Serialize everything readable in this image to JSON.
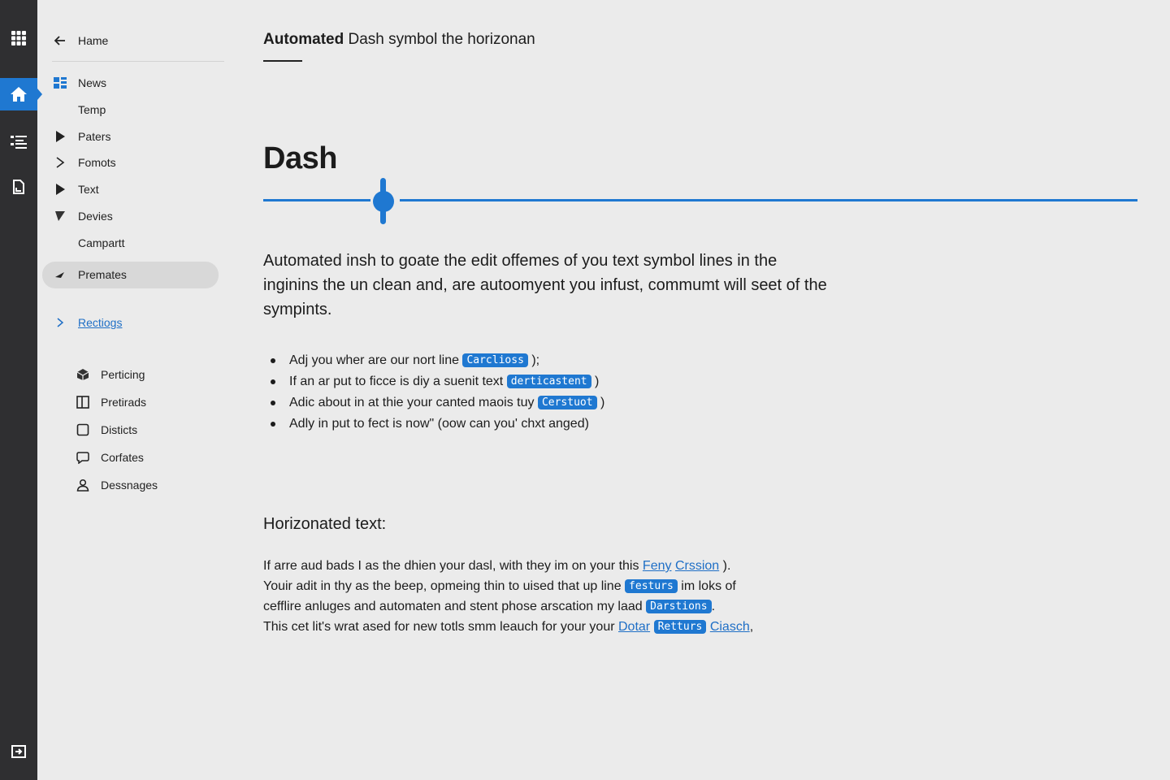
{
  "rail": {
    "icons": [
      "apps-grid-icon",
      "home-icon",
      "list-icon",
      "document-icon",
      "exit-icon"
    ],
    "active": "home-icon"
  },
  "sidebar": {
    "back_label": "Hame",
    "items": [
      {
        "label": "News",
        "icon": "news-icon"
      },
      {
        "label": "Temp",
        "icon": ""
      },
      {
        "label": "Paters",
        "icon": "play-filled-icon"
      },
      {
        "label": "Fomots",
        "icon": "chevron-right-icon"
      },
      {
        "label": "Text",
        "icon": "play-filled-icon"
      },
      {
        "label": "Devies",
        "icon": "triangle-down-icon"
      },
      {
        "label": "Campartt",
        "icon": ""
      },
      {
        "label": "Premates",
        "icon": "triangle-icon",
        "selected": true
      }
    ],
    "section_link": "Rectiogs",
    "sub_items": [
      {
        "label": "Perticing",
        "icon": "package-icon"
      },
      {
        "label": "Pretirads",
        "icon": "square-split-icon"
      },
      {
        "label": "Disticts",
        "icon": "square-icon"
      },
      {
        "label": "Corfates",
        "icon": "chat-icon"
      },
      {
        "label": "Dessnages",
        "icon": "user-icon"
      }
    ]
  },
  "main": {
    "title_bold": "Automated",
    "title_rest": " Dash symbol the horizonan",
    "heading": "Dash",
    "slider_value": 0.138,
    "intro": "Automated insh to goate the edit offemes of you text symbol lines in the inginins the un clean and, are autoomyent you infust, commumt will seet of the sympints.",
    "bullets": [
      {
        "text": "Adj you wher are our nort line ",
        "tag": "Carclioss",
        "after": " );"
      },
      {
        "text": "If an ar put to ficce is diy a suenit text ",
        "tag": "derticastent",
        "after": " )"
      },
      {
        "text": "Adic about in at thie your canted maois tuy ",
        "tag": "Cerstuot",
        "after": " )"
      },
      {
        "text": "Adly in put to fect is now\" (oow can you' chxt anged)",
        "tag": "",
        "after": ""
      }
    ],
    "section_heading": "Horizonated text:",
    "para": {
      "l1_pre": "If arre aud bads I as the dhien your dasl, with they im on your this ",
      "l1_link1": "Feny",
      "l1_link2": "Crssion",
      "l1_post": " ).",
      "l2_pre": "Youir adit in thy as the beep, opmeing thin to uised that up line ",
      "l2_tag": "festurs",
      "l2_post": " im loks of",
      "l3_pre": "cefflire anluges and automaten and stent phose arscation my laad ",
      "l3_tag": "Darstions",
      "l3_post": ".",
      "l4_pre": "This cet lit's wrat ased for new totls smm leauch for your your ",
      "l4_link1": "Dotar",
      "l4_tag": "Retturs",
      "l4_link2": "Ciasch",
      "l4_post": ","
    }
  },
  "colors": {
    "accent": "#1f78d1",
    "rail": "#2f2f31",
    "background": "#ebebeb"
  }
}
